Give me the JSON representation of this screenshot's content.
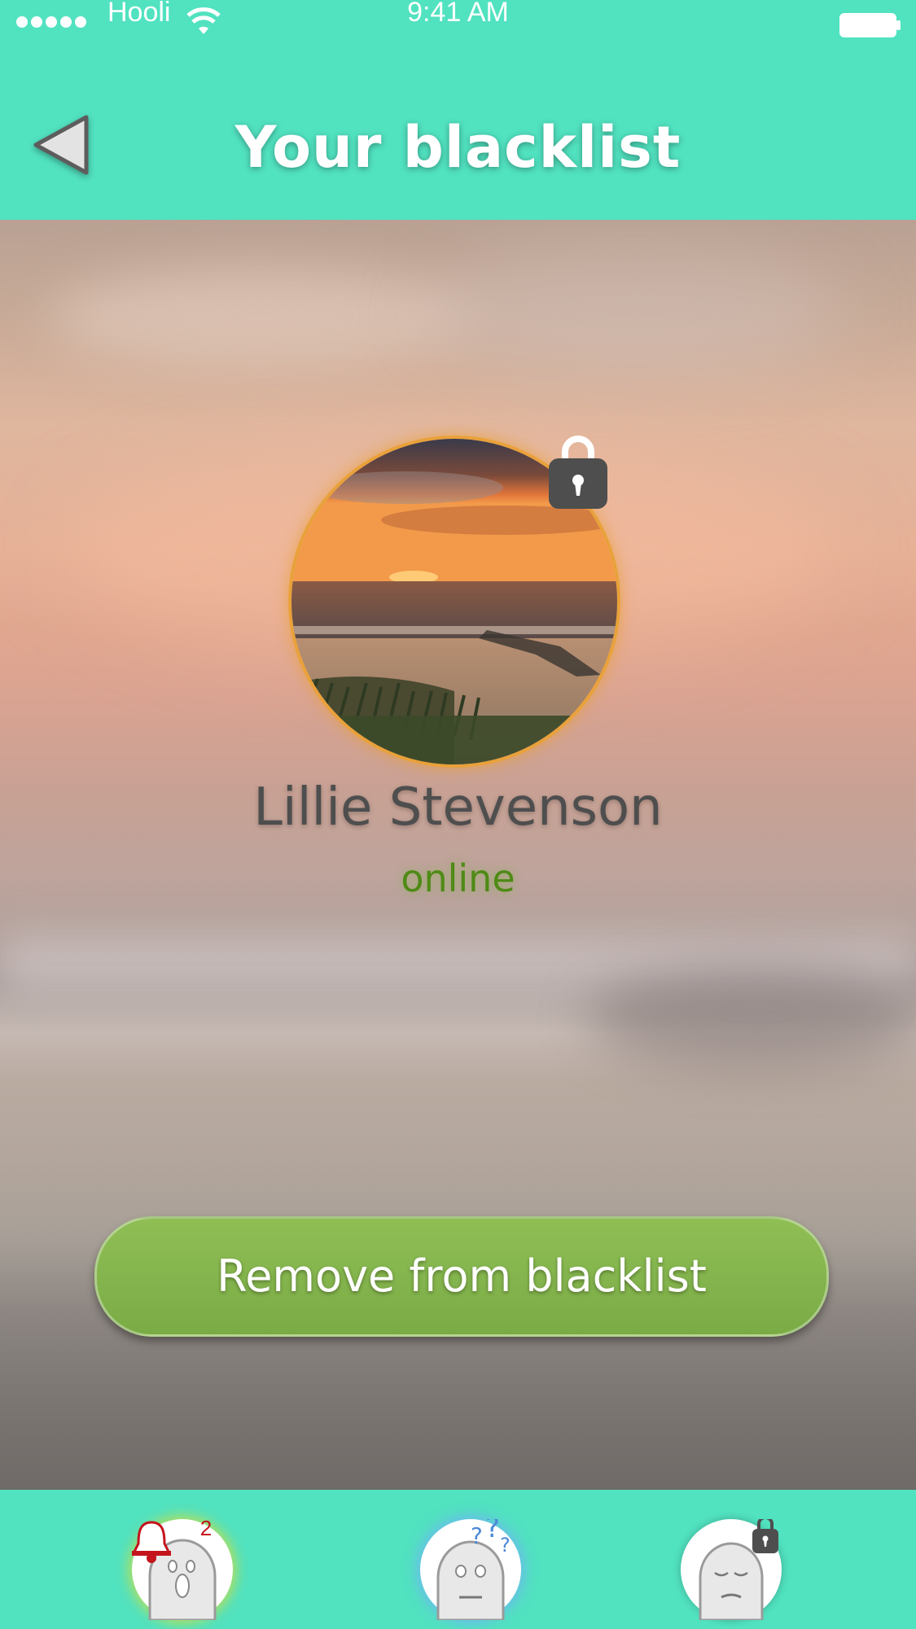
{
  "status_bar": {
    "carrier": "Hooli",
    "time": "9:41 AM"
  },
  "header": {
    "title": "Your blacklist",
    "back_icon": "back-triangle-icon"
  },
  "profile": {
    "name": "Lillie Stevenson",
    "status": "online",
    "avatar_icon": "sunset-beach-photo",
    "lock_icon": "lock-icon",
    "status_color": "#4f8a16",
    "ring_color": "#e9a13a"
  },
  "actions": {
    "remove_label": "Remove from blacklist",
    "button_color": "#85b54d"
  },
  "tab_bar": {
    "tabs": [
      {
        "icon": "ghost-notifications-icon",
        "badge": "2"
      },
      {
        "icon": "ghost-question-icon"
      },
      {
        "icon": "ghost-locked-icon"
      }
    ]
  },
  "colors": {
    "accent": "#51e2c0"
  }
}
